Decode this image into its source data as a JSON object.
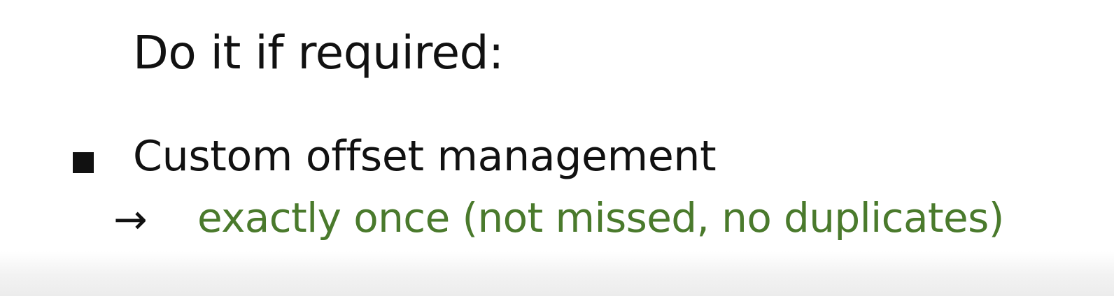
{
  "slide": {
    "heading": "Do it if required:",
    "bullets": [
      {
        "label": "Custom offset management",
        "sub": {
          "arrow": "→",
          "text": "exactly once (not missed, no duplicates)"
        }
      }
    ]
  },
  "colors": {
    "text": "#111111",
    "accent_green": "#4a7a2c",
    "background": "#ffffff"
  },
  "icons": {
    "bullet": "square-bullet-icon",
    "arrow": "right-arrow-icon"
  }
}
